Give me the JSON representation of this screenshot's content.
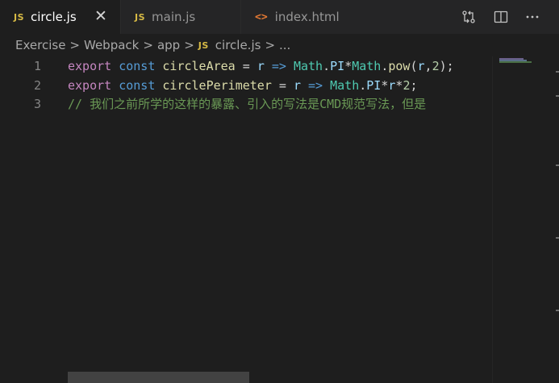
{
  "tabs": [
    {
      "badge": "JS",
      "label": "circle.js",
      "active": true,
      "close": "✕"
    },
    {
      "badge": "JS",
      "label": "main.js",
      "active": false
    },
    {
      "badge": "<>",
      "label": "index.html",
      "active": false
    }
  ],
  "actions": [
    "compare-changes-icon",
    "split-editor-icon",
    "more-actions-icon"
  ],
  "breadcrumb": {
    "items": [
      "Exercise",
      "Webpack",
      "app"
    ],
    "file_badge": "JS",
    "file": "circle.js",
    "ellipsis": "...",
    "separator": ">"
  },
  "editor": {
    "lines": [
      {
        "number": "1",
        "tokens": [
          {
            "t": "export",
            "c": "kw"
          },
          {
            "t": " ",
            "c": "op"
          },
          {
            "t": "const",
            "c": "st"
          },
          {
            "t": " ",
            "c": "op"
          },
          {
            "t": "circleArea",
            "c": "fn"
          },
          {
            "t": " = ",
            "c": "op"
          },
          {
            "t": "r",
            "c": "id"
          },
          {
            "t": " ",
            "c": "op"
          },
          {
            "t": "=>",
            "c": "st"
          },
          {
            "t": " ",
            "c": "op"
          },
          {
            "t": "Math",
            "c": "ty"
          },
          {
            "t": ".",
            "c": "op"
          },
          {
            "t": "PI",
            "c": "id"
          },
          {
            "t": "*",
            "c": "op"
          },
          {
            "t": "Math",
            "c": "ty"
          },
          {
            "t": ".",
            "c": "op"
          },
          {
            "t": "pow",
            "c": "fn"
          },
          {
            "t": "(",
            "c": "op"
          },
          {
            "t": "r",
            "c": "id"
          },
          {
            "t": ",",
            "c": "op"
          },
          {
            "t": "2",
            "c": "nm"
          },
          {
            "t": ");",
            "c": "op"
          }
        ]
      },
      {
        "number": "2",
        "tokens": [
          {
            "t": "export",
            "c": "kw"
          },
          {
            "t": " ",
            "c": "op"
          },
          {
            "t": "const",
            "c": "st"
          },
          {
            "t": " ",
            "c": "op"
          },
          {
            "t": "circlePerimeter",
            "c": "fn"
          },
          {
            "t": " = ",
            "c": "op"
          },
          {
            "t": "r",
            "c": "id"
          },
          {
            "t": " ",
            "c": "op"
          },
          {
            "t": "=>",
            "c": "st"
          },
          {
            "t": " ",
            "c": "op"
          },
          {
            "t": "Math",
            "c": "ty"
          },
          {
            "t": ".",
            "c": "op"
          },
          {
            "t": "PI",
            "c": "id"
          },
          {
            "t": "*",
            "c": "op"
          },
          {
            "t": "r",
            "c": "id"
          },
          {
            "t": "*",
            "c": "op"
          },
          {
            "t": "2",
            "c": "nm"
          },
          {
            "t": ";",
            "c": "op"
          }
        ]
      },
      {
        "number": "3",
        "tokens": [
          {
            "t": "// 我们之前所学的这样的暴露、引入的写法是CMD规范写法，但是",
            "c": "cm"
          }
        ]
      }
    ]
  },
  "colors": {
    "background": "#1e1e1e",
    "tabbar": "#252526",
    "js_badge": "#d7ba45",
    "html_badge": "#e37933",
    "keyword": "#c586c0",
    "storage": "#569cd6",
    "function": "#dcdcaa",
    "variable": "#9cdcfe",
    "type": "#4ec9b0",
    "number": "#b5cea8",
    "comment": "#6a9955"
  }
}
